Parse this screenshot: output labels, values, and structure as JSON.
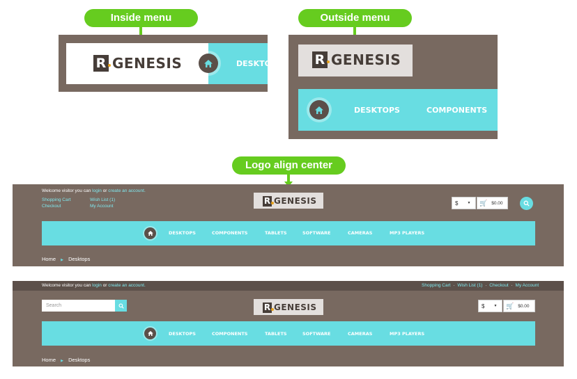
{
  "callouts": {
    "inside": "Inside menu",
    "outside": "Outside menu",
    "center": "Logo align center"
  },
  "logo": {
    "letter": "R",
    "word": "GENESIS"
  },
  "nav": {
    "desktops": "DESKTOPS",
    "components": "COMPONENTS",
    "desktop_trunc": "DESKTO",
    "items": [
      "DESKTOPS",
      "COMPONENTS",
      "TABLETS",
      "SOFTWARE",
      "CAMERAS",
      "MP3 PLAYERS"
    ]
  },
  "header": {
    "welcome": "Welcome visitor you can",
    "login": "login",
    "or": "or",
    "create": "create an account.",
    "shopping_cart": "Shopping Cart",
    "wish_list": "Wish List (1)",
    "checkout": "Checkout",
    "my_account": "My Account"
  },
  "currency": {
    "symbol": "$",
    "total": "$0.00"
  },
  "search": {
    "placeholder": "Search"
  },
  "breadcrumb": {
    "home": "Home",
    "current": "Desktops"
  },
  "colors": {
    "brown": "#786960",
    "teal": "#68dde2",
    "green": "#66cc1f",
    "dark": "#463d38"
  }
}
